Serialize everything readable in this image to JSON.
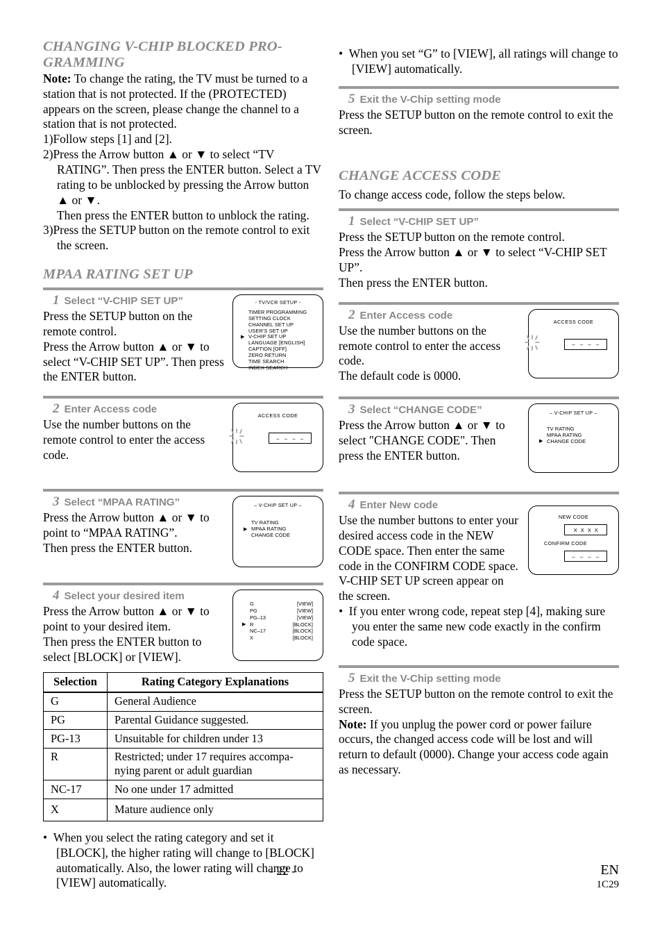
{
  "left_column": {
    "section1": {
      "heading": "CHANGING V-CHIP BLOCKED PRO-GRAMMING",
      "note_label": "Note:",
      "note_text": " To change the rating, the TV must be turned to a station that is not protected. If the (PROTECTED) appears on the screen, please change the channel to a station that is not protected.",
      "steps": [
        "1)Follow steps [1] and [2].",
        "2)Press the Arrow button ▲ or ▼ to select “TV RATING”. Then press the ENTER button. Select a TV rating to be unblocked by pressing the Arrow button ▲ or ▼.",
        "Then press the ENTER button to unblock the rating.",
        "3)Press the SETUP button on the remote control to exit the screen."
      ]
    },
    "section2": {
      "heading": "MPAA RATING SET UP",
      "steps": [
        {
          "num": "1",
          "label": "Select “V-CHIP SET UP”",
          "body1": "Press the SETUP button on the remote control.",
          "body2": "Press the Arrow button ▲ or ▼ to select “V-CHIP SET UP”. Then press the ENTER button."
        },
        {
          "num": "2",
          "label": "Enter Access code",
          "body1": "Use the number buttons on the remote control to enter the access code.",
          "body2": ""
        },
        {
          "num": "3",
          "label": "Select “MPAA RATING”",
          "body1": "Press the Arrow button ▲ or ▼ to point to “MPAA RATING”.",
          "body2": "Then press the ENTER button."
        },
        {
          "num": "4",
          "label": "Select your desired item",
          "body1": "Press the Arrow button ▲ or ▼ to point to your desired item.",
          "body2": "Then press the ENTER button to select [BLOCK] or [VIEW]."
        }
      ],
      "bullet": "When you select the rating category and set it [BLOCK], the higher rating will change to [BLOCK] automatically.  Also, the lower rating will change to [VIEW] automatically."
    },
    "screens": {
      "tvvcr_setup": {
        "title": "- TV/VCR SETUP -",
        "items": [
          {
            "label": "TIMER PROGRAMMING",
            "cursor": false
          },
          {
            "label": "SETTING CLOCK",
            "cursor": false
          },
          {
            "label": "CHANNEL SET UP",
            "cursor": false
          },
          {
            "label": "USER'S SET UP",
            "cursor": false
          },
          {
            "label": "V-CHIP SET UP",
            "cursor": true
          },
          {
            "label": "LANGUAGE  [ENGLISH]",
            "cursor": false
          },
          {
            "label": "CAPTION  [OFF]",
            "cursor": false
          },
          {
            "label": "ZERO RETURN",
            "cursor": false
          },
          {
            "label": "TIME SEARCH",
            "cursor": false
          },
          {
            "label": "INDEX SEARCH",
            "cursor": false
          }
        ]
      },
      "access_code": {
        "title": "ACCESS CODE",
        "value": "– – – –"
      },
      "vchip_setup_mpaa": {
        "title": "– V-CHIP SET UP –",
        "items": [
          {
            "label": "TV RATING",
            "cursor": false
          },
          {
            "label": "MPAA RATING",
            "cursor": true
          },
          {
            "label": "CHANGE CODE",
            "cursor": false
          }
        ]
      },
      "mpaa_ratings": {
        "rows": [
          {
            "name": "G",
            "value": "[VIEW]",
            "cursor": false
          },
          {
            "name": "PG",
            "value": "[VIEW]",
            "cursor": false
          },
          {
            "name": "PG–13",
            "value": "[VIEW]",
            "cursor": false
          },
          {
            "name": "R",
            "value": "[BLOCK]",
            "cursor": true
          },
          {
            "name": "NC–17",
            "value": "[BLOCK]",
            "cursor": false
          },
          {
            "name": "X",
            "value": "[BLOCK]",
            "cursor": false
          }
        ]
      }
    },
    "rating_table": {
      "headers": [
        "Selection",
        "Rating Category Explanations"
      ],
      "rows": [
        {
          "selection": "G",
          "explanation": "General Audience"
        },
        {
          "selection": "PG",
          "explanation": "Parental Guidance suggested."
        },
        {
          "selection": "PG-13",
          "explanation": "Unsuitable for children under 13"
        },
        {
          "selection": "R",
          "explanation": "Restricted; under 17 requires accompa-nying parent or adult guardian"
        },
        {
          "selection": "NC-17",
          "explanation": "No one under 17 admitted"
        },
        {
          "selection": "X",
          "explanation": "Mature audience only"
        }
      ]
    }
  },
  "right_column": {
    "top_bullet": "When you set “G” to [VIEW], all ratings will change to [VIEW] automatically.",
    "step5_mpaa": {
      "num": "5",
      "label": "Exit the V-Chip setting mode",
      "body": "Press the SETUP button on the remote control to exit the screen."
    },
    "section": {
      "heading": "CHANGE ACCESS CODE",
      "intro": "To change access code, follow the steps below.",
      "steps": [
        {
          "num": "1",
          "label": "Select “V-CHIP SET UP”",
          "body1": "Press the SETUP button on the remote control.",
          "body2": "Press the Arrow button ▲ or ▼ to select “V-CHIP SET UP”.",
          "body3": "Then press the ENTER button."
        },
        {
          "num": "2",
          "label": "Enter Access code",
          "body1": "Use the number buttons on the remote control to enter the access code.",
          "body2": "The default code is 0000."
        },
        {
          "num": "3",
          "label": "Select “CHANGE CODE”",
          "body1": "Press the Arrow button ▲ or ▼ to select \"CHANGE CODE\". Then press the ENTER button."
        },
        {
          "num": "4",
          "label": "Enter New code",
          "body1": "Use the number buttons to enter your desired access code in the NEW CODE space. Then enter the same code in the CONFIRM CODE space. V-CHIP SET UP screen appear on the screen.",
          "bullet": "If you enter wrong code, repeat step [4], making sure you enter the same new code exactly in the confirm code space."
        },
        {
          "num": "5",
          "label": "Exit the V-Chip setting mode",
          "body1": "Press the SETUP button on the remote control to exit the screen.",
          "note_label": "Note:",
          "note_text": " If you unplug the power cord or power failure occurs, the changed access code will be lost and will return to default (0000). Change your access code again as necessary."
        }
      ]
    },
    "screens": {
      "access_code": {
        "title": "ACCESS CODE",
        "value": "– – – –"
      },
      "vchip_setup_change": {
        "title": "– V-CHIP SET UP –",
        "items": [
          {
            "label": "TV RATING",
            "cursor": false
          },
          {
            "label": "MPAA RATING",
            "cursor": false
          },
          {
            "label": "CHANGE CODE",
            "cursor": true
          }
        ]
      },
      "new_code": {
        "new_label": "NEW CODE",
        "new_value": "X X X X",
        "confirm_label": "CONFIRM CODE",
        "confirm_value": "– – – –"
      }
    }
  },
  "footer": {
    "page_number": "- 22 -",
    "language": "EN",
    "doc_code": "1C29"
  }
}
